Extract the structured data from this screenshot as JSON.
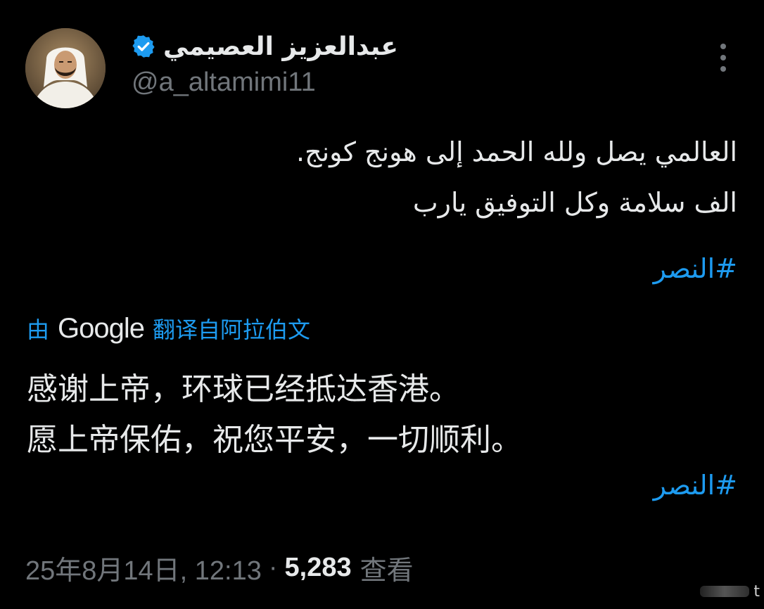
{
  "author": {
    "display_name": "عبدالعزيز العصيمي",
    "handle": "@a_altamimi11",
    "verified": true,
    "avatar_icon": "profile-photo",
    "verified_color": "#1d9bf0"
  },
  "tweet": {
    "lines": [
      "العالمي يصل ولله الحمد إلى هونج كونج.",
      "الف سلامة وكل التوفيق يارب"
    ],
    "hashtag": "#النصر"
  },
  "translation": {
    "by": "由",
    "provider": "Google",
    "from_label": "翻译自阿拉伯文",
    "lines": [
      "感谢上帝，环球已经抵达香港。",
      "愿上帝保佑，祝您平安，一切顺利。"
    ],
    "hashtag": "#النصر"
  },
  "meta": {
    "timestamp": "25年8月14日, 12:13",
    "separator": "·",
    "views_count": "5,283",
    "views_label": "查看"
  },
  "watermark": {
    "text": "t"
  },
  "colors": {
    "background": "#000000",
    "text": "#e7e9ea",
    "secondary": "#71767b",
    "accent": "#1d9bf0"
  }
}
